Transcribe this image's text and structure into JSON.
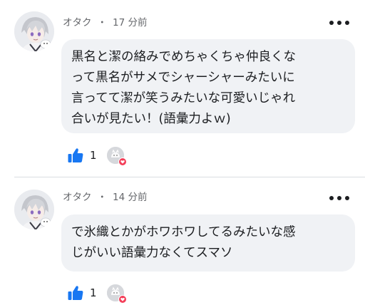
{
  "comments": [
    {
      "author": "オタク",
      "separator": "・",
      "time": "17 分前",
      "lines": [
        "黒名と潔の絡みでめちゃくちゃ仲良くな",
        "って黒名がサメでシャーシャーみたいに",
        "言ってて潔が笑うみたいな可愛いじゃれ",
        "合いが見たい！(語彙力よｗ)"
      ],
      "like_count": "1",
      "like_icon": "thumbs-up-icon",
      "reaction_icon": "heart-icon"
    },
    {
      "author": "オタク",
      "separator": "・",
      "time": "14 分前",
      "lines": [
        "で氷織とかがホワホワしてるみたいな感",
        "じがいい語彙力なくてスマソ"
      ],
      "like_count": "1",
      "like_icon": "thumbs-up-icon",
      "reaction_icon": "heart-icon"
    }
  ],
  "colors": {
    "like_blue": "#1877f2",
    "heart_red": "#f33e58",
    "bubble_bg": "#f0f2f5",
    "meta_gray": "#65676b"
  }
}
